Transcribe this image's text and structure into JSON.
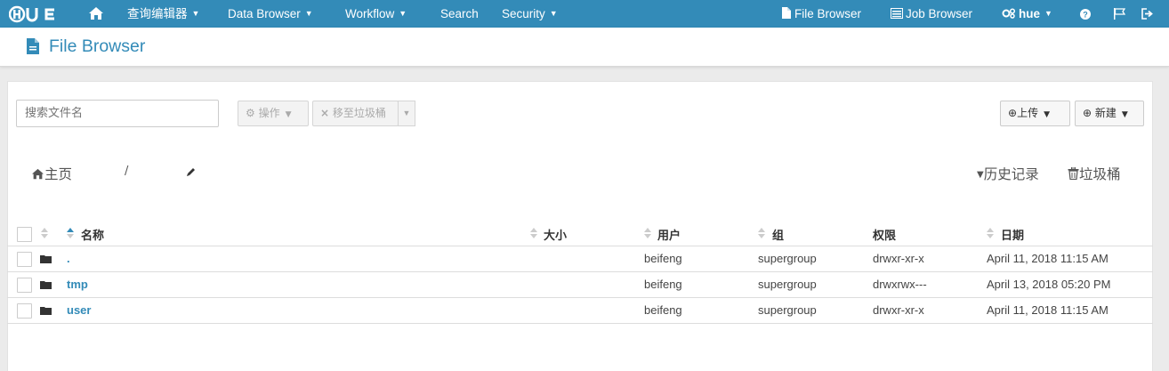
{
  "nav": {
    "logo": "HUE",
    "items": [
      "查询编辑器",
      "Data Browser",
      "Workflow",
      "Search",
      "Security"
    ],
    "right_items": [
      "File Browser",
      "Job Browser",
      "hue"
    ]
  },
  "header": {
    "title": "File Browser"
  },
  "toolbar": {
    "search_placeholder": "搜索文件名",
    "actions_label": "操作",
    "trash_label": "移至垃圾桶",
    "upload_label": "上传",
    "new_label": "新建"
  },
  "breadcrumb": {
    "home": "主页",
    "separator": "/"
  },
  "history_label": "历史记录",
  "trash_link": "垃圾桶",
  "table": {
    "columns": [
      "名称",
      "大小",
      "用户",
      "组",
      "权限",
      "日期"
    ],
    "rows": [
      {
        "name": ".",
        "size": "",
        "user": "beifeng",
        "group": "supergroup",
        "perm": "drwxr-xr-x",
        "date": "April 11, 2018 11:15 AM"
      },
      {
        "name": "tmp",
        "size": "",
        "user": "beifeng",
        "group": "supergroup",
        "perm": "drwxrwx---",
        "date": "April 13, 2018 05:20 PM"
      },
      {
        "name": "user",
        "size": "",
        "user": "beifeng",
        "group": "supergroup",
        "perm": "drwxr-xr-x",
        "date": "April 11, 2018 11:15 AM"
      }
    ]
  },
  "colors": {
    "nav_bg": "#338bb8",
    "link": "#338bb8"
  }
}
